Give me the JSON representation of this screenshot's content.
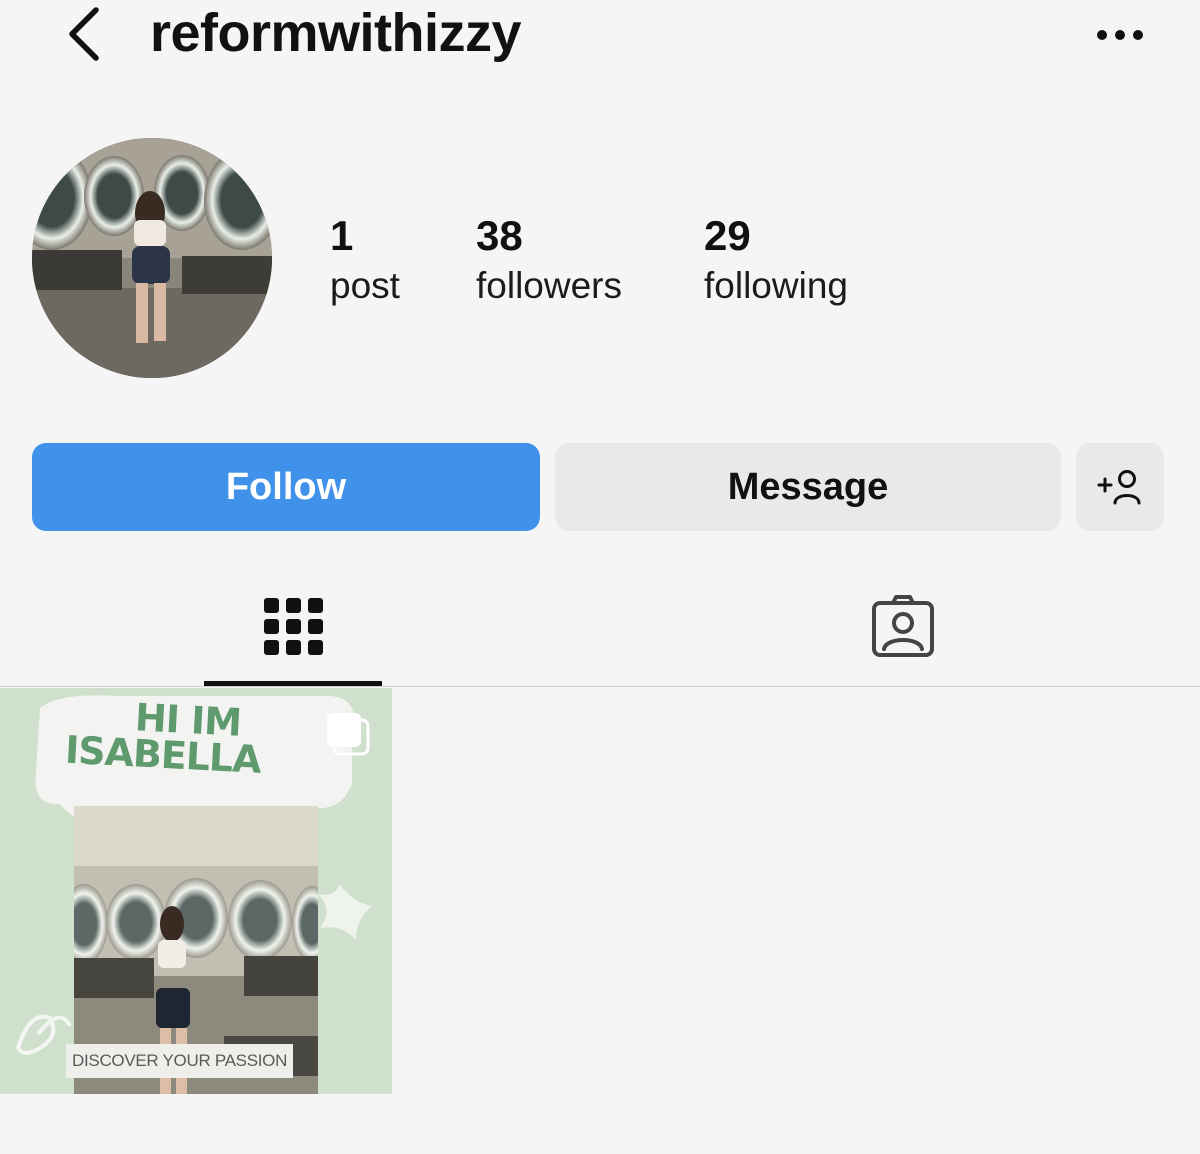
{
  "header": {
    "username": "reformwithizzy",
    "back_icon": "chevron-left-icon",
    "more_icon": "more-horizontal-icon"
  },
  "profile": {
    "avatar_icon": "profile-photo"
  },
  "stats": {
    "posts": {
      "value": "1",
      "label": "post"
    },
    "followers": {
      "value": "38",
      "label": "followers"
    },
    "following": {
      "value": "29",
      "label": "following"
    }
  },
  "actions": {
    "follow_label": "Follow",
    "message_label": "Message",
    "add_user_icon": "add-user-icon"
  },
  "tabs": {
    "active": "grid",
    "grid_icon": "grid-icon",
    "tagged_icon": "tagged-person-icon"
  },
  "posts": [
    {
      "title_line1": "HI IM",
      "title_line2": "ISABELLA",
      "caption": "DISCOVER YOUR PASSION",
      "multi_icon": "carousel-icon"
    }
  ],
  "colors": {
    "background": "#f5f5f5",
    "follow_button": "#3f91ea",
    "secondary_button": "#e9e9ea",
    "post_bg": "#cfe1cc",
    "post_accent": "#5f9a6e"
  }
}
